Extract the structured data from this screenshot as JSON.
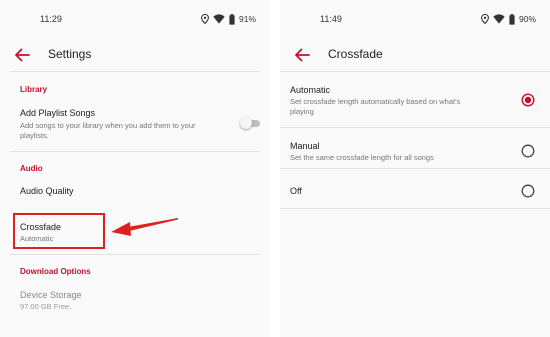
{
  "left": {
    "status_time": "11:29",
    "battery": "91%",
    "title": "Settings",
    "sections": {
      "library": "Library",
      "audio": "Audio",
      "download": "Download Options"
    },
    "items": {
      "add_playlist_songs": {
        "title": "Add Playlist Songs",
        "subtitle_line1": "Add songs to your library when you add them to your",
        "subtitle_line2": "playlists.",
        "toggle_on": false
      },
      "audio_quality": {
        "title": "Audio Quality"
      },
      "crossfade": {
        "title": "Crossfade",
        "subtitle": "Automatic"
      },
      "device_storage": {
        "title": "Device Storage",
        "subtitle": "97.00 GB Free."
      }
    }
  },
  "right": {
    "status_time": "11:49",
    "battery": "90%",
    "title": "Crossfade",
    "options": [
      {
        "title": "Automatic",
        "subtitle_line1": "Set crossfade length automatically based on what's",
        "subtitle_line2": "playing",
        "selected": true
      },
      {
        "title": "Manual",
        "subtitle_line1": "Set the same crossfade length for all songs",
        "selected": false
      },
      {
        "title": "Off",
        "selected": false
      }
    ]
  },
  "colors": {
    "accent": "#c8102e",
    "annotation": "#e02020",
    "background": "#fafafa",
    "divider": "#e2e2e2"
  },
  "icons": [
    "location-icon",
    "wifi-icon",
    "battery-icon",
    "back-arrow-icon",
    "radio-selected-icon",
    "radio-unselected-icon",
    "annotation-arrow"
  ]
}
